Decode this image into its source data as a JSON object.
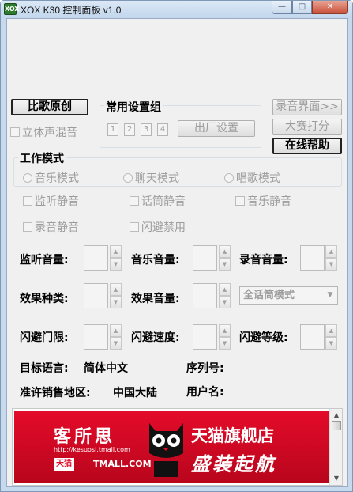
{
  "window": {
    "title": "XOX K30 控制面板 v1.0",
    "icon_text": "XOX",
    "min_glyph": "—",
    "max_glyph": "□",
    "close_glyph": "✕"
  },
  "buttons": {
    "compare": "比歌原创",
    "factory": "出厂设置",
    "record_ui": "录音界面>>",
    "contest": "大赛打分",
    "help": "在线帮助"
  },
  "stereo_mix": "立体声混音",
  "preset_group": {
    "title": "常用设置组",
    "numbers": [
      "1",
      "2",
      "3",
      "4"
    ]
  },
  "work_mode": {
    "title": "工作模式",
    "modes": [
      "音乐模式",
      "聊天模式",
      "唱歌模式"
    ]
  },
  "mutes": {
    "monitor": "监听静音",
    "mic": "话筒静音",
    "music": "音乐静音",
    "record": "录音静音",
    "dodge_disable": "闪避禁用"
  },
  "volumes": {
    "monitor": "监听音量:",
    "music": "音乐音量:",
    "record": "录音音量:"
  },
  "effects": {
    "type": "效果种类:",
    "volume": "效果音量:",
    "mode_value": "全话筒模式"
  },
  "dodge": {
    "threshold": "闪避门限:",
    "speed": "闪避速度:",
    "level": "闪避等级:"
  },
  "info": {
    "language_label": "目标语言:",
    "language_value": "简体中文",
    "serial_label": "序列号:",
    "region_label": "准许销售地区:",
    "region_value": "中国大陆",
    "user_label": "用户名:"
  },
  "banner": {
    "brand": "客所思",
    "url": "http://kesuosi.tmall.com",
    "tmall_badge": "天猫",
    "tmall_text": "TMALL.COM",
    "store": "天猫旗舰店",
    "slogan": "盛装起航"
  },
  "spin_up": "▲",
  "spin_down": "▼",
  "combo_arrow": "▼"
}
